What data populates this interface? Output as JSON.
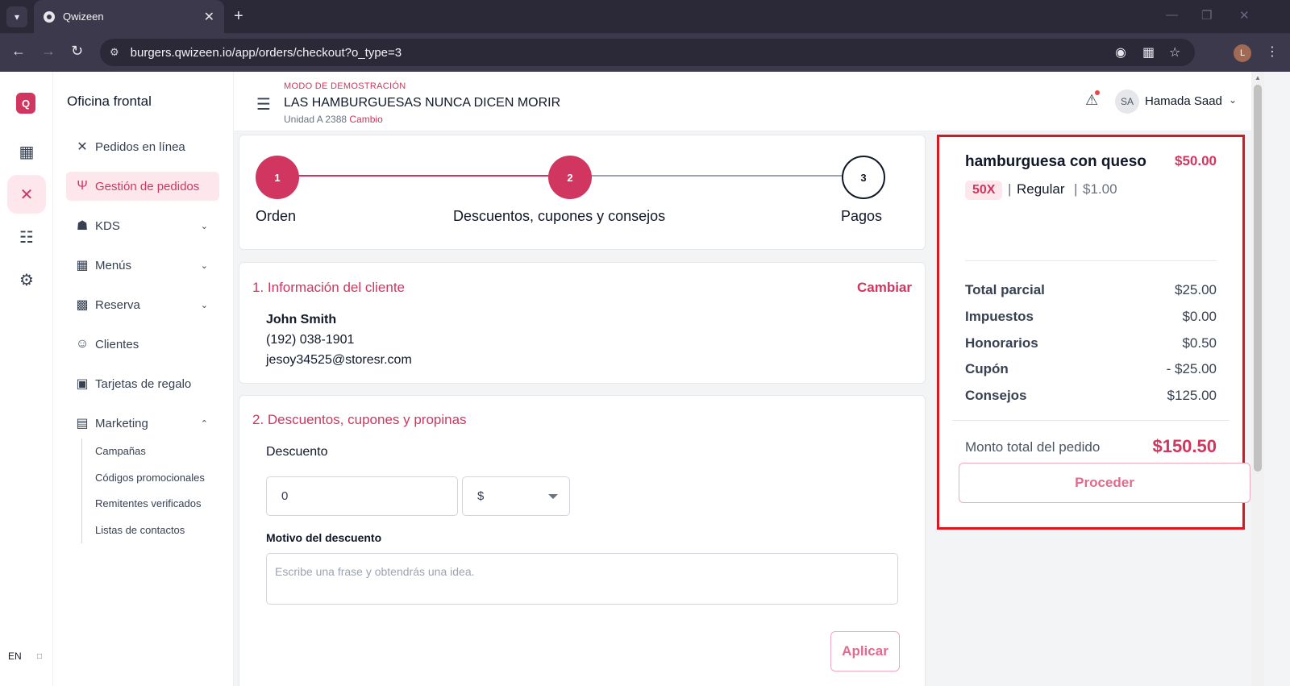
{
  "browser": {
    "tab_title": "Qwizeen",
    "url": "burgers.qwizeen.io/app/orders/checkout?o_type=3",
    "profile_initial": "L"
  },
  "rail": {
    "logo": "Q",
    "lang": "EN",
    "icons": [
      "dashboard-icon",
      "orders-icon",
      "org-chart-icon",
      "settings-icon"
    ]
  },
  "sidebar": {
    "title": "Oficina frontal",
    "items": [
      {
        "label": "Pedidos en línea",
        "icon": "utensils-cross-icon"
      },
      {
        "label": "Gestión de pedidos",
        "icon": "fork-knife-icon"
      },
      {
        "label": "KDS",
        "icon": "chef-hat-icon"
      },
      {
        "label": "Menús",
        "icon": "grid-icon"
      },
      {
        "label": "Reserva",
        "icon": "table-icon"
      },
      {
        "label": "Clientes",
        "icon": "users-icon"
      },
      {
        "label": "Tarjetas de regalo",
        "icon": "gift-icon"
      },
      {
        "label": "Marketing",
        "icon": "bar-chart-icon"
      }
    ],
    "marketing_sub": [
      "Campañas",
      "Códigos promocionales",
      "Remitentes verificados",
      "Listas de contactos"
    ]
  },
  "header": {
    "demo_mode": "MODO DE DEMOSTRACIÓN",
    "store_name": "LAS HAMBURGUESAS NUNCA DICEN MORIR",
    "unit": "Unidad A 2388",
    "change": "Cambio",
    "user_initials": "SA",
    "user_name": "Hamada Saad"
  },
  "stepper": {
    "steps": [
      {
        "number": "1",
        "label": "Orden"
      },
      {
        "number": "2",
        "label": "Descuentos, cupones y consejos"
      },
      {
        "number": "3",
        "label": "Pagos"
      }
    ]
  },
  "customer": {
    "section_title": "1. Información del cliente",
    "change_label": "Cambiar",
    "name": "John Smith",
    "phone": "(192) 038-1901",
    "email": "jesoy34525@storesr.com"
  },
  "discounts": {
    "section_title": "2. Descuentos, cupones y propinas",
    "discount_label": "Descuento",
    "discount_value": "0",
    "currency": "$",
    "reason_label": "Motivo del descuento",
    "reason_placeholder": "Escribe una frase y obtendrás una idea.",
    "apply_label": "Aplicar"
  },
  "summary": {
    "item_name": "hamburguesa con queso",
    "item_price": "$50.00",
    "quantity": "50X",
    "variant": "Regular",
    "unit_price": "$1.00",
    "rows": [
      {
        "label": "Total parcial",
        "value": "$25.00"
      },
      {
        "label": "Impuestos",
        "value": "$0.00"
      },
      {
        "label": "Honorarios",
        "value": "$0.50"
      },
      {
        "label": "Cupón",
        "value": "- $25.00"
      },
      {
        "label": "Consejos",
        "value": "$125.00"
      }
    ],
    "total_label": "Monto total del pedido",
    "total_value": "$150.50",
    "proceed_label": "Proceder"
  },
  "colors": {
    "brand": "#d0365f",
    "highlight_border": "#e0141e"
  }
}
